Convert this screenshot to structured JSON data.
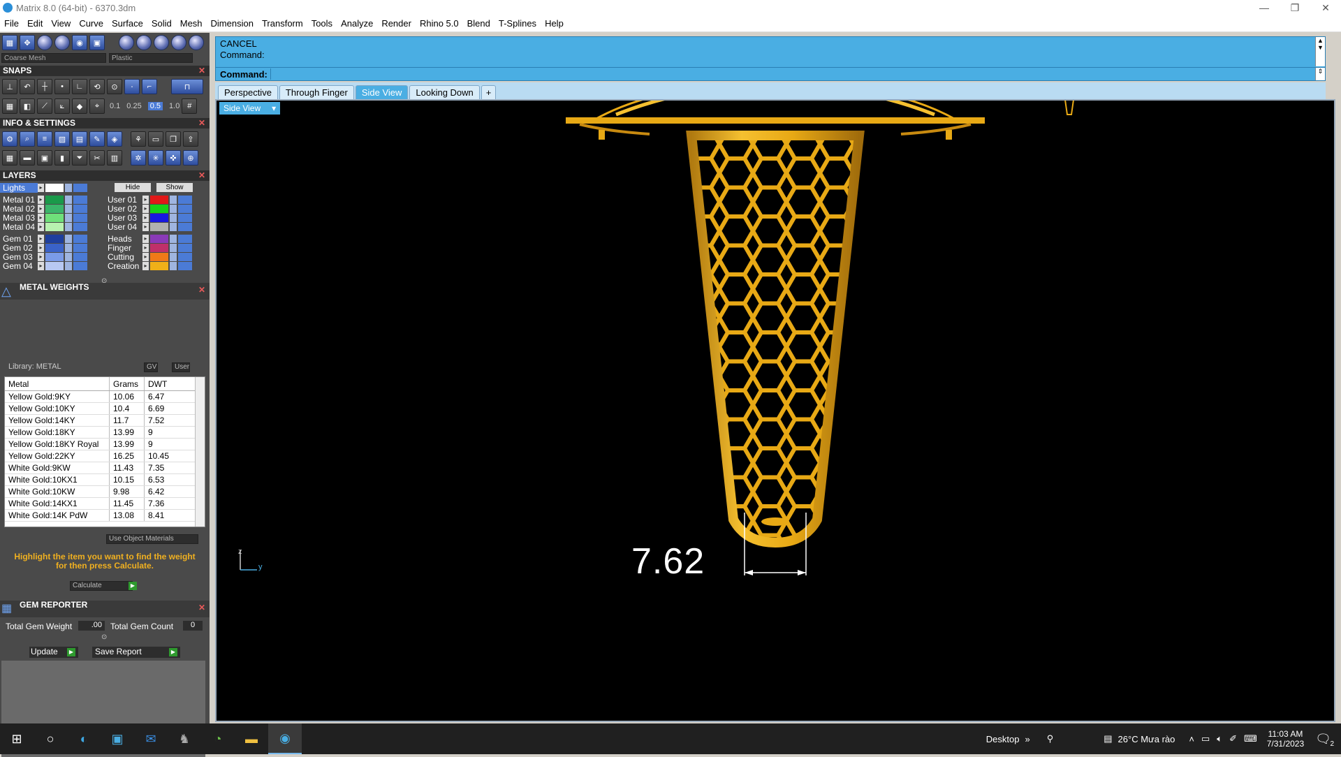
{
  "window": {
    "title": "Matrix 8.0 (64-bit) - 6370.3dm",
    "minimize": "—",
    "maximize": "❐",
    "close": "✕"
  },
  "menu": [
    "File",
    "Edit",
    "View",
    "Curve",
    "Surface",
    "Solid",
    "Mesh",
    "Dimension",
    "Transform",
    "Tools",
    "Analyze",
    "Render",
    "Rhino 5.0",
    "Blend",
    "T-Splines",
    "Help"
  ],
  "render_toolbar": {
    "mesh_select": "Coarse Mesh",
    "material_select": "Plastic"
  },
  "snaps": {
    "title": "SNAPS",
    "values": [
      "0.1",
      "0.25",
      "0.5",
      "1.0"
    ]
  },
  "info_settings": {
    "title": "INFO & SETTINGS"
  },
  "layers": {
    "title": "LAYERS",
    "lights_label": "Lights",
    "hide_label": "Hide",
    "show_label": "Show",
    "left": [
      {
        "name": "Metal 01",
        "color": "#1a9a4a"
      },
      {
        "name": "Metal 02",
        "color": "#3bb56a"
      },
      {
        "name": "Metal 03",
        "color": "#6fe07a"
      },
      {
        "name": "Metal 04",
        "color": "#b8f2b0"
      },
      {
        "name": "Gem 01",
        "color": "#1e3f9e"
      },
      {
        "name": "Gem 02",
        "color": "#3a62c8"
      },
      {
        "name": "Gem 03",
        "color": "#7a9be8"
      },
      {
        "name": "Gem 04",
        "color": "#b8c9f2"
      }
    ],
    "right": [
      {
        "name": "User 01",
        "color": "#e01818"
      },
      {
        "name": "User 02",
        "color": "#18d018"
      },
      {
        "name": "User 03",
        "color": "#1818e0"
      },
      {
        "name": "User 04",
        "color": "#b0b0b0"
      },
      {
        "name": "Heads",
        "color": "#8a3ab8"
      },
      {
        "name": "Finger",
        "color": "#c0306a"
      },
      {
        "name": "Cutting",
        "color": "#f07a18"
      },
      {
        "name": "Creation",
        "color": "#f0b018"
      }
    ]
  },
  "metal_weights": {
    "title": "METAL WEIGHTS",
    "library": "Library: METAL",
    "gv_label": "GV",
    "user_label": "User",
    "headers": [
      "Metal",
      "Grams",
      "DWT"
    ],
    "rows": [
      [
        "Yellow Gold:9KY",
        "10.06",
        "6.47"
      ],
      [
        "Yellow Gold:10KY",
        "10.4",
        "6.69"
      ],
      [
        "Yellow Gold:14KY",
        "11.7",
        "7.52"
      ],
      [
        "Yellow Gold:18KY",
        "13.99",
        "9"
      ],
      [
        "Yellow Gold:18KY Royal",
        "13.99",
        "9"
      ],
      [
        "Yellow Gold:22KY",
        "16.25",
        "10.45"
      ],
      [
        "White Gold:9KW",
        "11.43",
        "7.35"
      ],
      [
        "White Gold:10KX1",
        "10.15",
        "6.53"
      ],
      [
        "White Gold:10KW",
        "9.98",
        "6.42"
      ],
      [
        "White Gold:14KX1",
        "11.45",
        "7.36"
      ],
      [
        "White Gold:14K PdW",
        "13.08",
        "8.41"
      ]
    ],
    "use_object_materials": "Use Object Materials",
    "instruction": "Highlight the item you want to find the weight for then press Calculate.",
    "calculate": "Calculate"
  },
  "gem_reporter": {
    "title": "GEM REPORTER",
    "total_weight_label": "Total Gem Weight",
    "total_weight_value": ".00",
    "total_count_label": "Total Gem Count",
    "total_count_value": "0",
    "update": "Update",
    "save_report": "Save Report"
  },
  "command": {
    "history": [
      "CANCEL",
      "Command:"
    ],
    "prompt": "Command:",
    "input_value": ""
  },
  "view_tabs": [
    "Perspective",
    "Through Finger",
    "Side View",
    "Looking Down",
    "+"
  ],
  "active_view_tab": "Side View",
  "viewport": {
    "view_name": "Side View",
    "dimension_value": "7.62",
    "axis_z": "z",
    "axis_y": "y",
    "model_color": "#e8a915"
  },
  "taskbar": {
    "desktop_label": "Desktop",
    "weather": "26°C  Mưa rào",
    "time": "11:03 AM",
    "date": "7/31/2023",
    "notifications": "2"
  }
}
